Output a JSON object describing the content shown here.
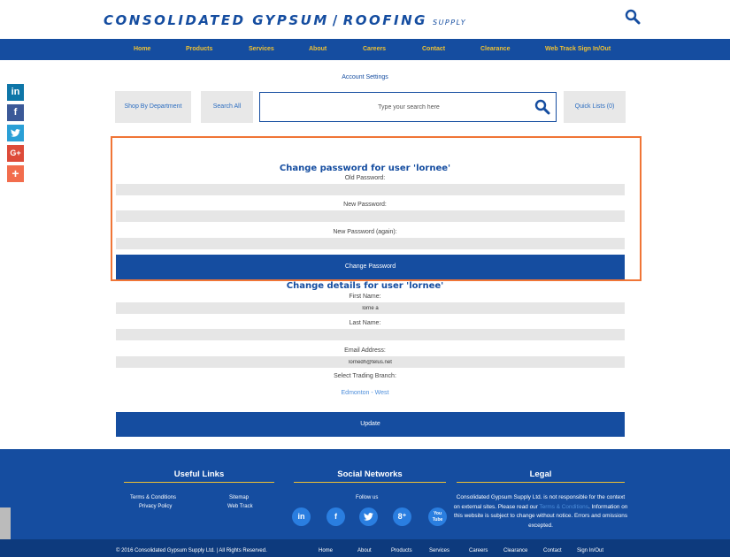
{
  "header": {
    "logo_part1": "Consolidated Gypsum",
    "logo_sep": "/",
    "logo_part2": "Roofing",
    "logo_supply": "supply"
  },
  "nav": [
    {
      "label": "Home"
    },
    {
      "label": "Products"
    },
    {
      "label": "Services"
    },
    {
      "label": "About"
    },
    {
      "label": "Careers"
    },
    {
      "label": "Contact"
    },
    {
      "label": "Clearance"
    },
    {
      "label": "Web Track Sign In/Out"
    }
  ],
  "social_sidebar": [
    {
      "icon": "linkedin-icon",
      "glyph": "in",
      "color": "#0e76a8"
    },
    {
      "icon": "facebook-icon",
      "glyph": "f",
      "color": "#3b5998"
    },
    {
      "icon": "twitter-icon",
      "glyph": "🐦",
      "color": "#2a9fd6"
    },
    {
      "icon": "google-plus-icon",
      "glyph": "G+",
      "color": "#dd4b39"
    },
    {
      "icon": "share-plus-icon",
      "glyph": "+",
      "color": "#f26d4d"
    }
  ],
  "account_settings_label": "Account Settings",
  "search": {
    "shop_by_department": "Shop By Department",
    "search_all": "Search All",
    "placeholder": "Type your search here",
    "quick_lists": "Quick Lists (0)"
  },
  "password_section": {
    "title": "Change password for user 'lornee'",
    "old_label": "Old Password:",
    "new_label": "New Password:",
    "again_label": "New Password (again):",
    "button": "Change Password"
  },
  "details_section": {
    "title": "Change details for user 'lornee'",
    "first_name_label": "First Name:",
    "first_name_value": "lorne a",
    "last_name_label": "Last Name:",
    "last_name_value": "",
    "email_label": "Email Address:",
    "email_value": "lornedh@telus.net",
    "branch_label": "Select Trading Branch:",
    "branch_value": "Edmonton - West",
    "button": "Update"
  },
  "footer": {
    "useful_links_title": "Useful Links",
    "useful_links": {
      "terms": "Terms & Conditions",
      "sitemap": "Sitemap",
      "privacy": "Privacy Policy",
      "web_track": "Web Track"
    },
    "social_title": "Social Networks",
    "follow_us": "Follow us",
    "social_circles": [
      {
        "icon": "linkedin-icon",
        "glyph": "in"
      },
      {
        "icon": "facebook-icon",
        "glyph": "f"
      },
      {
        "icon": "twitter-icon",
        "glyph": "🐦"
      },
      {
        "icon": "google-plus-icon",
        "glyph": "8⁺"
      },
      {
        "icon": "youtube-icon",
        "glyph": "You Tube"
      }
    ],
    "legal_title": "Legal",
    "legal_text_1": "Consolidated Gypsum Supply Ltd. is not responsible for the context on external sites. Please read our ",
    "legal_terms_link": "Terms & Conditions",
    "legal_text_2": ". Information on this website is subject to change without notice. Errors and omissions excepted.",
    "copyright": "© 2016 Consolidated Gypsum Supply Ltd. | All Rights Reserved.",
    "bottom_links": [
      "Home",
      "About",
      "Products",
      "Services",
      "Careers",
      "Clearance",
      "Contact",
      "Sign In/Out"
    ]
  },
  "colors": {
    "brand_blue": "#154da0",
    "nav_text": "#f1c232",
    "focus_outline": "#f07536",
    "link_blue": "#4d8edb"
  }
}
